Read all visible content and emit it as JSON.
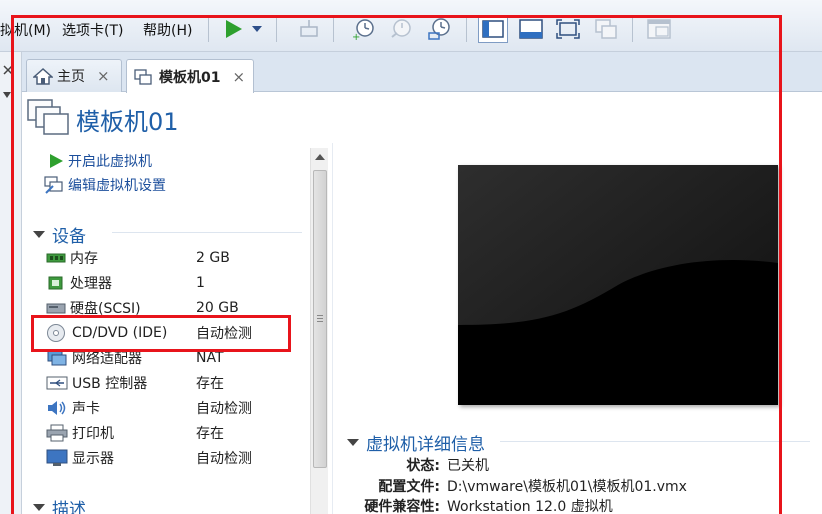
{
  "menu": {
    "vm": "拟机(M)",
    "tabs": "选项卡(T)",
    "help": "帮助(H)"
  },
  "tabs": [
    {
      "label": "主页",
      "close": "×"
    },
    {
      "label": "模板机01",
      "close": "×"
    }
  ],
  "vm": {
    "title": "模板机01"
  },
  "actions": {
    "power_on": "开启此虚拟机",
    "edit_settings": "编辑虚拟机设置"
  },
  "devices": {
    "section_title": "设备",
    "items": [
      {
        "name": "内存",
        "value": "2 GB",
        "icon": "memory-icon"
      },
      {
        "name": "处理器",
        "value": "1",
        "icon": "cpu-icon"
      },
      {
        "name": "硬盘(SCSI)",
        "value": "20 GB",
        "icon": "harddisk-icon"
      },
      {
        "name": "CD/DVD (IDE)",
        "value": "自动检测",
        "icon": "cdrom-icon"
      },
      {
        "name": "网络适配器",
        "value": "NAT",
        "icon": "network-icon"
      },
      {
        "name": "USB 控制器",
        "value": "存在",
        "icon": "usb-icon"
      },
      {
        "name": "声卡",
        "value": "自动检测",
        "icon": "sound-icon"
      },
      {
        "name": "打印机",
        "value": "存在",
        "icon": "printer-icon"
      },
      {
        "name": "显示器",
        "value": "自动检测",
        "icon": "monitor-icon"
      }
    ]
  },
  "description": {
    "section_title": "描述"
  },
  "details": {
    "section_title": "虚拟机详细信息",
    "rows": [
      {
        "key": "状态:",
        "value": "已关机"
      },
      {
        "key": "配置文件:",
        "value": "D:\\vmware\\模板机01\\模板机01.vmx"
      },
      {
        "key": "硬件兼容性:",
        "value": "Workstation 12.0 虚拟机"
      }
    ]
  },
  "colors": {
    "accent": "#1f5fa8",
    "annotation": "#e8141b",
    "play": "#2ea02e"
  }
}
